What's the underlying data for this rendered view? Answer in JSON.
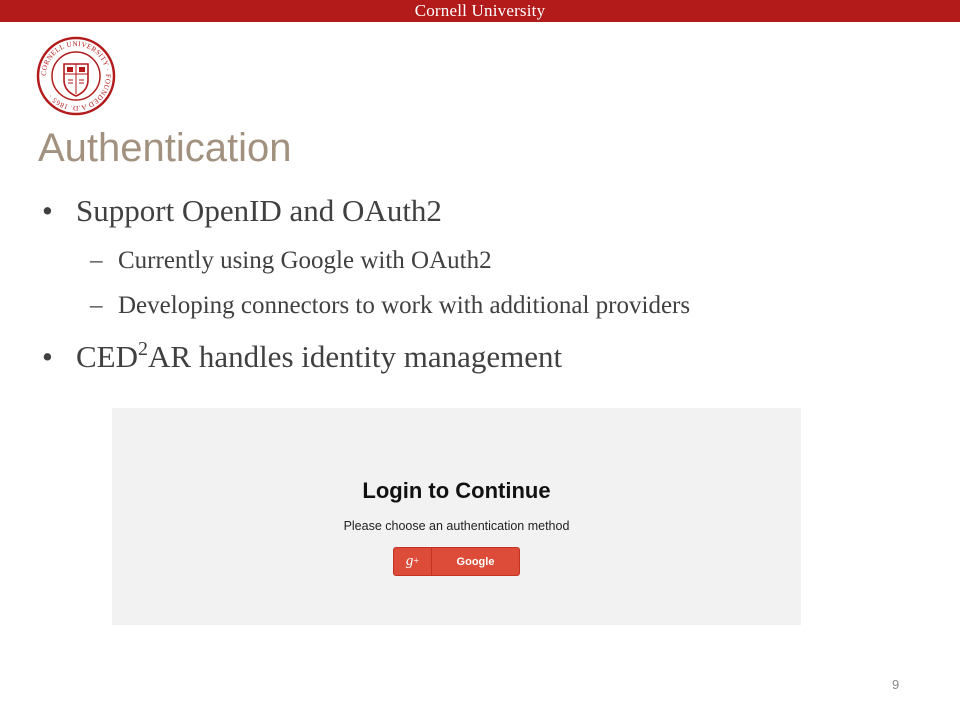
{
  "header": {
    "university": "Cornell University"
  },
  "seal": {
    "ring_text": "CORNELL UNIVERSITY · FOUNDED A.D. 1865 ·",
    "color": "#b31b1b"
  },
  "slide": {
    "title": "Authentication",
    "bullet1": "Support OpenID and OAuth2",
    "sub1": "Currently using Google with OAuth2",
    "sub2": "Developing connectors to work with additional providers",
    "bullet2_pre": "CED",
    "bullet2_sup": "2",
    "bullet2_post": "AR handles identity management",
    "bullet_glyph": "•",
    "dash_glyph": "–"
  },
  "screenshot": {
    "heading": "Login to Continue",
    "subheading": "Please choose an authentication method",
    "google_icon": "g",
    "google_icon_sup": "+",
    "google_label": "Google",
    "button_color": "#dd4b39"
  },
  "footer": {
    "page_number": "9"
  },
  "colors": {
    "accent": "#b31b1b",
    "title": "#a39180",
    "text": "#404040"
  }
}
